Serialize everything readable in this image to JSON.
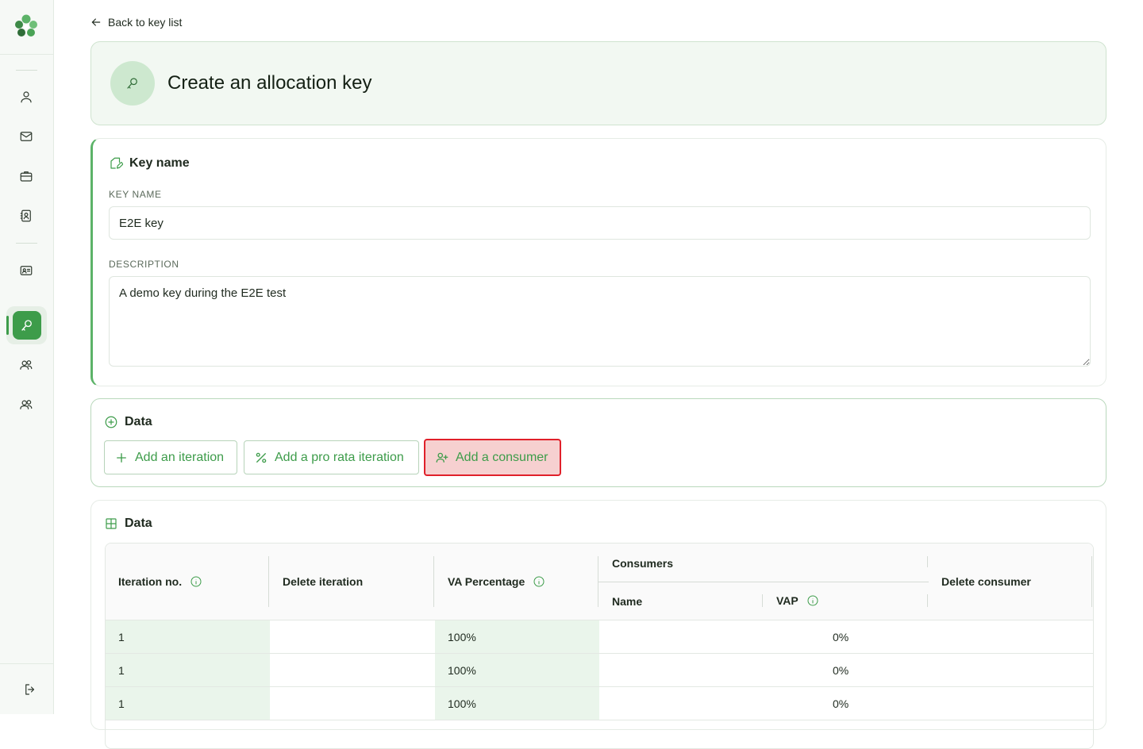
{
  "nav": {
    "back_label": "Back to key list"
  },
  "header": {
    "title": "Create an allocation key"
  },
  "key_section": {
    "title": "Key name",
    "name_label": "KEY NAME",
    "name_value": "E2E key",
    "description_label": "DESCRIPTION",
    "description_value": "A demo key during the E2E test"
  },
  "data_actions": {
    "title": "Data",
    "add_iteration": "Add an iteration",
    "add_pro_rata": "Add a pro rata iteration",
    "add_consumer": "Add a consumer"
  },
  "table_section": {
    "title": "Data",
    "headers": {
      "iteration": "Iteration no.",
      "delete_iteration": "Delete iteration",
      "va_percentage": "VA Percentage",
      "consumers": "Consumers",
      "name": "Name",
      "vap": "VAP",
      "delete_consumer": "Delete consumer"
    },
    "rows": [
      {
        "iteration": "1",
        "va": "100%",
        "vap": "0%"
      },
      {
        "iteration": "1",
        "va": "100%",
        "vap": "0%"
      },
      {
        "iteration": "1",
        "va": "100%",
        "vap": "0%"
      }
    ]
  },
  "colors": {
    "accent": "#3d9c4a",
    "highlight_border": "#e0202a",
    "highlight_fill": "#f6d0d0"
  }
}
